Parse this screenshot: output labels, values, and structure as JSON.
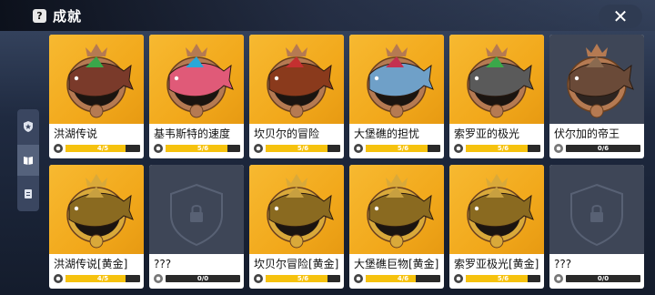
{
  "header": {
    "help_icon": "?",
    "title": "成就",
    "close_icon": "✕"
  },
  "sidebar": {
    "tabs": [
      {
        "icon": "shield-star-icon",
        "active": false
      },
      {
        "icon": "book-icon",
        "active": true
      },
      {
        "icon": "document-icon",
        "active": false
      }
    ]
  },
  "colors": {
    "gold": "#f2a91c",
    "locked": "#3e4657",
    "progress": "#f6c20e"
  },
  "achievements": [
    {
      "name": "洪湖传说",
      "progress_text": "4/5",
      "progress": 0.8,
      "style": "gold",
      "fish": "#7a3a2a",
      "accent": "#3aa84a",
      "medal_icon": "bronze-medal-icon"
    },
    {
      "name": "基韦斯特的速度",
      "progress_text": "5/6",
      "progress": 0.83,
      "style": "gold",
      "fish": "#e05a78",
      "accent": "#2aa8d8",
      "medal_icon": "bronze-medal-icon"
    },
    {
      "name": "坎贝尔的冒险",
      "progress_text": "5/6",
      "progress": 0.83,
      "style": "gold",
      "fish": "#8a3a1c",
      "accent": "#c43030",
      "medal_icon": "bronze-medal-icon"
    },
    {
      "name": "大堡礁的担忧",
      "progress_text": "5/6",
      "progress": 0.83,
      "style": "gold",
      "fish": "#6fa0c8",
      "accent": "#c43050",
      "medal_icon": "bronze-medal-icon"
    },
    {
      "name": "索罗亚的极光",
      "progress_text": "5/6",
      "progress": 0.83,
      "style": "gold",
      "fish": "#5a5a5a",
      "accent": "#3aa84a",
      "medal_icon": "bronze-medal-icon"
    },
    {
      "name": "伏尔加的帝王",
      "progress_text": "0/6",
      "progress": 0.0,
      "style": "grey",
      "fish": "#6a4a38",
      "accent": "#8a6a50",
      "medal_icon": "bronze-medal-icon"
    },
    {
      "name": "洪湖传说[黄金]",
      "progress_text": "4/5",
      "progress": 0.8,
      "style": "gold",
      "fish": "#8a6a20",
      "accent": "#c8a040",
      "medal_icon": "gold-medal-icon"
    },
    {
      "name": "???",
      "progress_text": "0/0",
      "progress": 0.0,
      "style": "locked",
      "medal_icon": "lock-medal-icon"
    },
    {
      "name": "坎贝尔冒险[黄金]",
      "progress_text": "5/6",
      "progress": 0.83,
      "style": "gold",
      "fish": "#8a6a20",
      "accent": "#c8a040",
      "medal_icon": "gold-medal-icon"
    },
    {
      "name": "大堡礁巨物[黄金]",
      "progress_text": "4/6",
      "progress": 0.67,
      "style": "gold",
      "fish": "#8a6a20",
      "accent": "#c8a040",
      "medal_icon": "gold-medal-icon"
    },
    {
      "name": "索罗亚极光[黄金]",
      "progress_text": "5/6",
      "progress": 0.83,
      "style": "gold",
      "fish": "#8a6a20",
      "accent": "#c8a040",
      "medal_icon": "gold-medal-icon"
    },
    {
      "name": "???",
      "progress_text": "0/0",
      "progress": 0.0,
      "style": "locked",
      "medal_icon": "lock-medal-icon"
    }
  ]
}
